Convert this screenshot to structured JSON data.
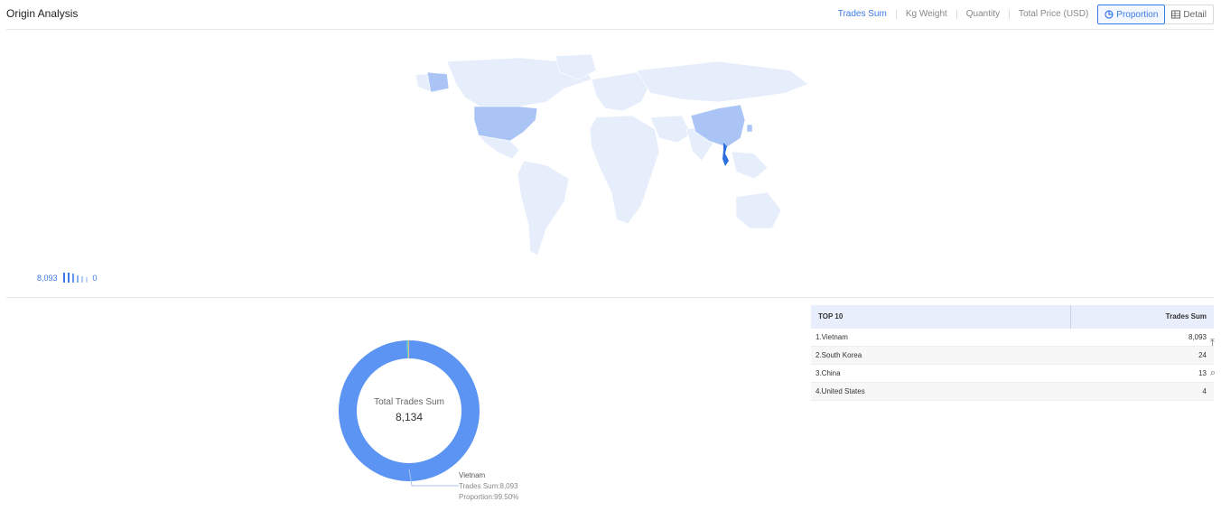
{
  "header": {
    "title": "Origin Analysis",
    "tabs": [
      "Trades Sum",
      "Kg Weight",
      "Quantity",
      "Total Price (USD)"
    ],
    "proportion_label": "Proportion",
    "detail_label": "Detail"
  },
  "map_legend": {
    "max": "8,093",
    "min": "0"
  },
  "donut": {
    "center_label": "Total Trades Sum",
    "center_value": "8,134",
    "callout": {
      "name": "Vietnam",
      "trades_line": "Trades Sum:8,093",
      "proportion_line": "Proportion:99.50%"
    }
  },
  "chart_data": {
    "type": "pie",
    "labels": [
      "Vietnam",
      "South Korea",
      "China",
      "United States"
    ],
    "values": [
      8093,
      24,
      13,
      4
    ],
    "colors": [
      "#5b94f2",
      "#5ad0c0",
      "#f5b94a",
      "#9a7fe0"
    ]
  },
  "table": {
    "header": {
      "name": "TOP 10",
      "value": "Trades Sum"
    },
    "rows": [
      {
        "name": "1.Vietnam",
        "value": "8,093"
      },
      {
        "name": "2.South Korea",
        "value": "24"
      },
      {
        "name": "3.China",
        "value": "13"
      },
      {
        "name": "4.United States",
        "value": "4"
      }
    ]
  }
}
